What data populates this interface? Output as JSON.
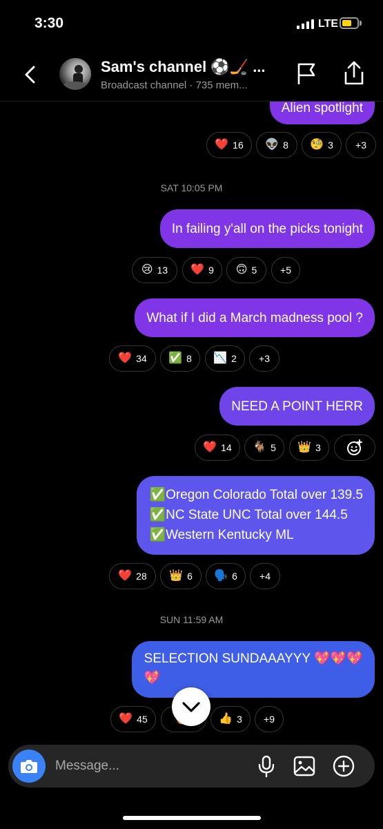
{
  "status": {
    "time": "3:30",
    "network": "LTE"
  },
  "header": {
    "title": "Sam's channel ⚽🏒 ...",
    "subtitle": "Broadcast channel · 735 mem..."
  },
  "messages": [
    {
      "text": [
        "Alien spotlight"
      ],
      "color": "#8035e6",
      "reactions": [
        {
          "emoji": "❤️",
          "count": "16"
        },
        {
          "emoji": "👽",
          "count": "8"
        },
        {
          "emoji": "🧐",
          "count": "3"
        },
        {
          "emoji": "",
          "count": "+3"
        }
      ]
    },
    {
      "timestamp": "SAT 10:05 PM",
      "text": [
        "In failing y'all on the picks tonight"
      ],
      "color": "#8035e6",
      "reactions": [
        {
          "emoji": "😢",
          "count": "13"
        },
        {
          "emoji": "❤️",
          "count": "9"
        },
        {
          "emoji": "🙃",
          "count": "5"
        },
        {
          "emoji": "",
          "count": "+5"
        }
      ]
    },
    {
      "text": [
        "What if I did a March madness pool ?"
      ],
      "color": "#8035e6",
      "reactions": [
        {
          "emoji": "❤️",
          "count": "34"
        },
        {
          "emoji": "✅",
          "count": "8"
        },
        {
          "emoji": "📉",
          "count": "2"
        },
        {
          "emoji": "",
          "count": "+3"
        }
      ]
    },
    {
      "text": [
        "NEED A POINT HERR"
      ],
      "color": "#6f45ea",
      "reactions": [
        {
          "emoji": "❤️",
          "count": "14"
        },
        {
          "emoji": "🐐",
          "count": "5"
        },
        {
          "emoji": "👑",
          "count": "3"
        },
        {
          "emoji": "add-reaction-icon",
          "count": ""
        }
      ]
    },
    {
      "text": [
        "✅Oregon Colorado Total over 139.5",
        "✅NC State UNC Total over 144.5",
        "✅Western Kentucky ML"
      ],
      "color": "#5d55ec",
      "reactions": [
        {
          "emoji": "❤️",
          "count": "28"
        },
        {
          "emoji": "👑",
          "count": "6"
        },
        {
          "emoji": "🗣️",
          "count": "6"
        },
        {
          "emoji": "",
          "count": "+4"
        }
      ]
    },
    {
      "timestamp": "SUN 11:59 AM",
      "text": [
        "SELECTION SUNDAAAYYY 💖💖💖",
        "💖"
      ],
      "color": "#3f5ee8",
      "reactions": [
        {
          "emoji": "❤️",
          "count": "45"
        },
        {
          "emoji": "🔥",
          "count": ""
        },
        {
          "emoji": "👍",
          "count": "3"
        },
        {
          "emoji": "",
          "count": "+9"
        }
      ]
    }
  ],
  "composer": {
    "placeholder": "Message..."
  }
}
